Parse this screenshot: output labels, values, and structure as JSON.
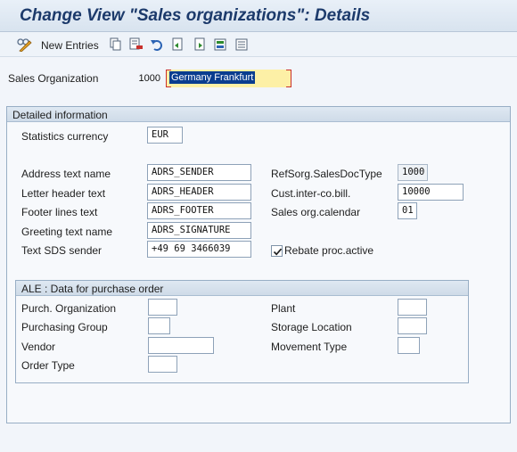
{
  "window": {
    "title": "Change View \"Sales organizations\": Details"
  },
  "toolbar": {
    "new_entries_label": "New Entries",
    "icons": [
      "change-display-icon",
      "copy-icon",
      "delete-icon",
      "undo-icon",
      "previous-entry-icon",
      "next-entry-icon",
      "select-all-icon",
      "deselect-icon"
    ]
  },
  "header": {
    "sales_org_label": "Sales Organization",
    "sales_org_value": "1000",
    "sales_org_text": "Germany Frankfurt"
  },
  "detailed": {
    "title": "Detailed information",
    "statistics_currency_label": "Statistics currency",
    "statistics_currency_value": "EUR",
    "address_text_label": "Address text name",
    "address_text_value": "ADRS_SENDER",
    "letter_header_label": "Letter header text",
    "letter_header_value": "ADRS_HEADER",
    "footer_lines_label": "Footer lines text",
    "footer_lines_value": "ADRS_FOOTER",
    "greeting_label": "Greeting text name",
    "greeting_value": "ADRS_SIGNATURE",
    "sds_sender_label": "Text SDS sender",
    "sds_sender_value": "+49 69 3466039",
    "refsorg_label": "RefSorg.SalesDocType",
    "refsorg_value": "1000",
    "cust_interco_label": "Cust.inter-co.bill.",
    "cust_interco_value": "10000",
    "calendar_label": "Sales org.calendar",
    "calendar_value": "01",
    "rebate_label": "Rebate proc.active",
    "rebate_checked": true
  },
  "ale": {
    "title": "ALE : Data for purchase order",
    "purch_org_label": "Purch. Organization",
    "purch_group_label": "Purchasing Group",
    "vendor_label": "Vendor",
    "order_type_label": "Order Type",
    "plant_label": "Plant",
    "storage_label": "Storage Location",
    "movement_label": "Movement Type"
  },
  "colors": {
    "title": "#1c3a6b",
    "highlight": "#fdf0a6",
    "selection": "#0a3d8f",
    "required_border": "#c9302c"
  }
}
